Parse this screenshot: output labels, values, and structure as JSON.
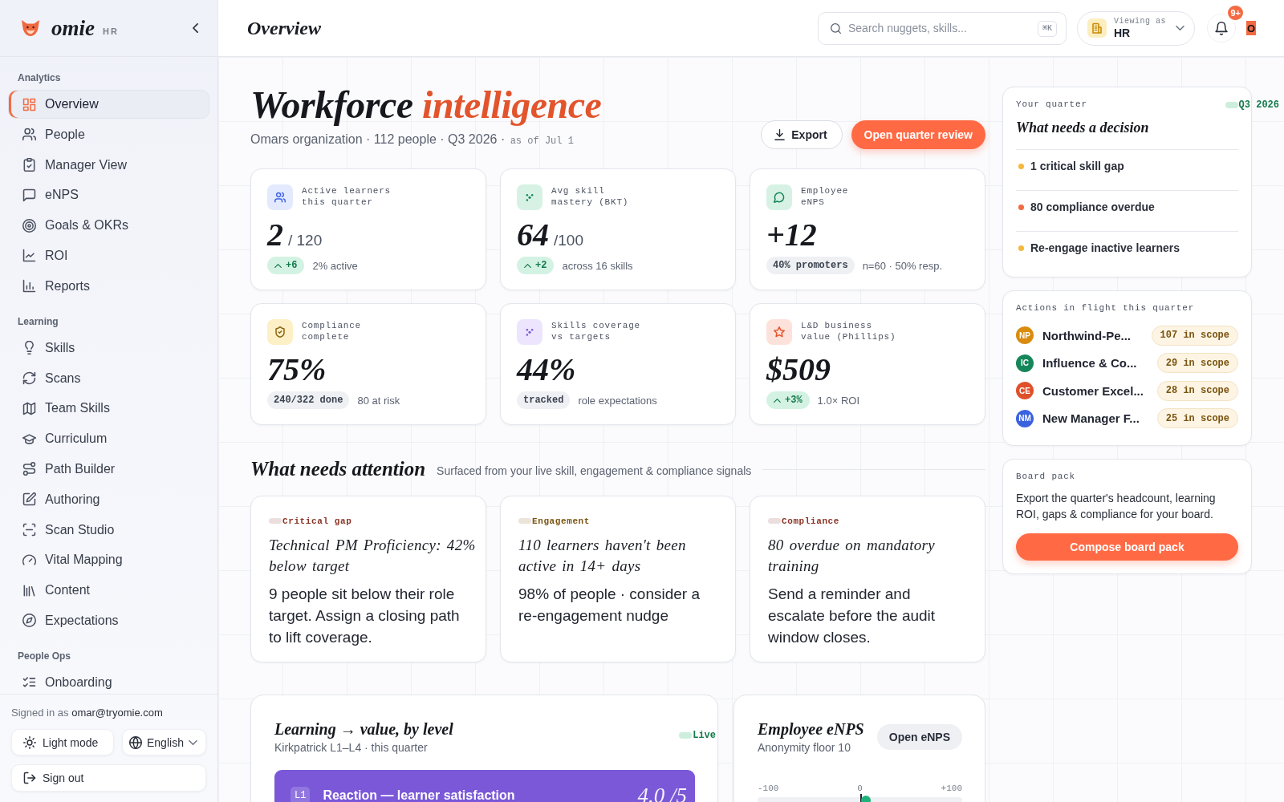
{
  "sidebar": {
    "brand": {
      "name": "omie",
      "tag": "HR"
    },
    "sections": [
      {
        "title": "Analytics",
        "items": [
          {
            "label": "Overview",
            "selected": true
          },
          {
            "label": "People",
            "selected": false
          },
          {
            "label": "Manager View",
            "selected": false
          },
          {
            "label": "eNPS",
            "selected": false
          },
          {
            "label": "Goals & OKRs",
            "selected": false
          },
          {
            "label": "ROI",
            "selected": false
          },
          {
            "label": "Reports",
            "selected": false
          }
        ]
      },
      {
        "title": "Learning",
        "items": [
          {
            "label": "Skills",
            "selected": false
          },
          {
            "label": "Scans",
            "selected": false
          },
          {
            "label": "Team Skills",
            "selected": false
          },
          {
            "label": "Curriculum",
            "selected": false
          },
          {
            "label": "Path Builder",
            "selected": false
          },
          {
            "label": "Authoring",
            "selected": false
          },
          {
            "label": "Scan Studio",
            "selected": false
          },
          {
            "label": "Vital Mapping",
            "selected": false
          },
          {
            "label": "Content",
            "selected": false
          },
          {
            "label": "Expectations",
            "selected": false
          }
        ]
      },
      {
        "title": "People Ops",
        "items": [
          {
            "label": "Onboarding",
            "selected": false
          }
        ]
      }
    ],
    "footer": {
      "signed_in_label": "Signed in as",
      "email": "omar@tryomie.com",
      "theme_button": "Light mode",
      "language_select": "English",
      "sign_out_button": "Sign out"
    }
  },
  "header": {
    "title": "Overview",
    "search": {
      "placeholder": "Search nuggets, skills...",
      "shortcut": "⌘K"
    },
    "viewing_as": {
      "label": "Viewing as",
      "value": "HR"
    },
    "notifications": {
      "badge": "9+"
    },
    "avatar": {
      "initial": "O"
    }
  },
  "hero": {
    "title": "Workforce",
    "title_accent": "intelligence",
    "subtitle": "Omars organization · 112 people · Q3 2026 ·",
    "as_of": "as of Jul 1",
    "buttons": [
      {
        "label": "Export",
        "kind": "secondary"
      },
      {
        "label": "Open quarter review",
        "kind": "primary"
      }
    ]
  },
  "stats": [
    {
      "label": "Active learners\nthis quarter",
      "value": "2",
      "unit": "/ 120",
      "badge": {
        "kind": "delta",
        "text": "+6"
      },
      "note": "2% active"
    },
    {
      "label": "Avg skill\nmastery (BKT)",
      "value": "64",
      "unit": "/100",
      "badge": {
        "kind": "delta",
        "text": "+2"
      },
      "note": "across 16 skills"
    },
    {
      "label": "Employee\neNPS",
      "value": "+12",
      "badge": {
        "kind": "neutral",
        "text": "40% promoters"
      },
      "note": "n=60 · 50% resp."
    },
    {
      "label": "Compliance\ncomplete",
      "value": "75%",
      "badge": {
        "kind": "neutral",
        "text": "240/322 done"
      },
      "note": "80 at risk"
    },
    {
      "label": "Skills coverage\nvs targets",
      "value": "44%",
      "badge": {
        "kind": "neutral",
        "text": "tracked"
      },
      "note": "role expectations"
    },
    {
      "label": "L&D business\nvalue (Phillips)",
      "value": "$509",
      "badge": {
        "kind": "delta",
        "text": "+3%"
      },
      "note": "1.0× ROI"
    }
  ],
  "attention": {
    "title": "What needs attention",
    "subtitle": "Surfaced from your live skill, engagement & compliance signals",
    "cards": [
      {
        "tag": "Critical gap",
        "color": "#8a3324",
        "title": "Technical PM Proficiency: 42% below target",
        "body": "9 people sit below their role target. Assign a closing path to lift coverage."
      },
      {
        "tag": "Engagement",
        "color": "#7a5412",
        "title": "110 learners haven't been active in 14+ days",
        "body": "98% of people · consider a re-engagement nudge"
      },
      {
        "tag": "Compliance",
        "color": "#8a3324",
        "title": "80 overdue on mandatory training",
        "body": "Send a reminder and escalate before the audit window closes."
      }
    ]
  },
  "learning_value": {
    "title": "Learning → value, by level",
    "subtitle": "Kirkpatrick L1–L4 · this quarter",
    "status": "Live",
    "levels": [
      {
        "code": "L1",
        "label": "Reaction — learner satisfaction",
        "score": "4.0 /5"
      }
    ]
  },
  "enps_panel": {
    "title": "Employee eNPS",
    "subtitle": "Anonymity floor 10",
    "button": "Open eNPS",
    "scale": {
      "ticks": [
        "-100",
        "0",
        "+100"
      ],
      "level": 0.53
    }
  },
  "quarter": {
    "label": "Your quarter",
    "period": "Q3 2026",
    "title": "What needs a decision",
    "items": [
      {
        "text": "1 critical skill gap",
        "color": "#f5b83d"
      },
      {
        "text": "80 compliance overdue",
        "color": "#f26b43"
      },
      {
        "text": "Re-engage inactive learners",
        "color": "#f5b83d"
      }
    ]
  },
  "actions": {
    "title": "Actions in flight this quarter",
    "items": [
      {
        "initials": "NP",
        "name": "Northwind-Pe...",
        "scope": "107 in scope",
        "color": "#d98b0e"
      },
      {
        "initials": "IC",
        "name": "Influence & Co...",
        "scope": "29 in scope",
        "color": "#15865a"
      },
      {
        "initials": "CE",
        "name": "Customer Excel...",
        "scope": "28 in scope",
        "color": "#e0502a"
      },
      {
        "initials": "NM",
        "name": "New Manager F...",
        "scope": "25 in scope",
        "color": "#3a62de"
      }
    ]
  },
  "board_pack": {
    "label": "Board pack",
    "text": "Export the quarter's headcount, learning ROI, gaps & compliance for your board.",
    "button": "Compose board pack"
  }
}
